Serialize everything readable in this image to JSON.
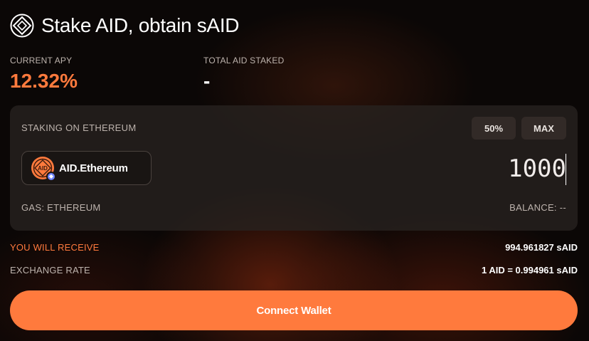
{
  "header": {
    "title": "Stake AID, obtain sAID",
    "logo_icon": "aid-diamond-logo-icon"
  },
  "stats": {
    "apy_label": "CURRENT APY",
    "apy_value": "12.32%",
    "staked_label": "TOTAL AID STAKED",
    "staked_value": "-"
  },
  "stake_card": {
    "network_label": "STAKING ON ETHEREUM",
    "pct_50_label": "50%",
    "max_label": "MAX",
    "token_name": "AID.Ethereum",
    "token_icon_text": "AID",
    "token_icon": "aid-token-icon",
    "chain_badge_icon": "ethereum-icon",
    "amount_value": "1000",
    "gas_label": "GAS: ETHEREUM",
    "balance_label": "BALANCE: --"
  },
  "summary": {
    "receive_label": "YOU WILL RECEIVE",
    "receive_value": "994.961827 sAID",
    "rate_label": "EXCHANGE RATE",
    "rate_value": "1 AID = 0.994961 sAID"
  },
  "connect_button": {
    "label": "Connect Wallet"
  },
  "colors": {
    "accent": "#ff7a3d",
    "card_bg": "#282220",
    "muted_text": "#bdb3ad"
  }
}
